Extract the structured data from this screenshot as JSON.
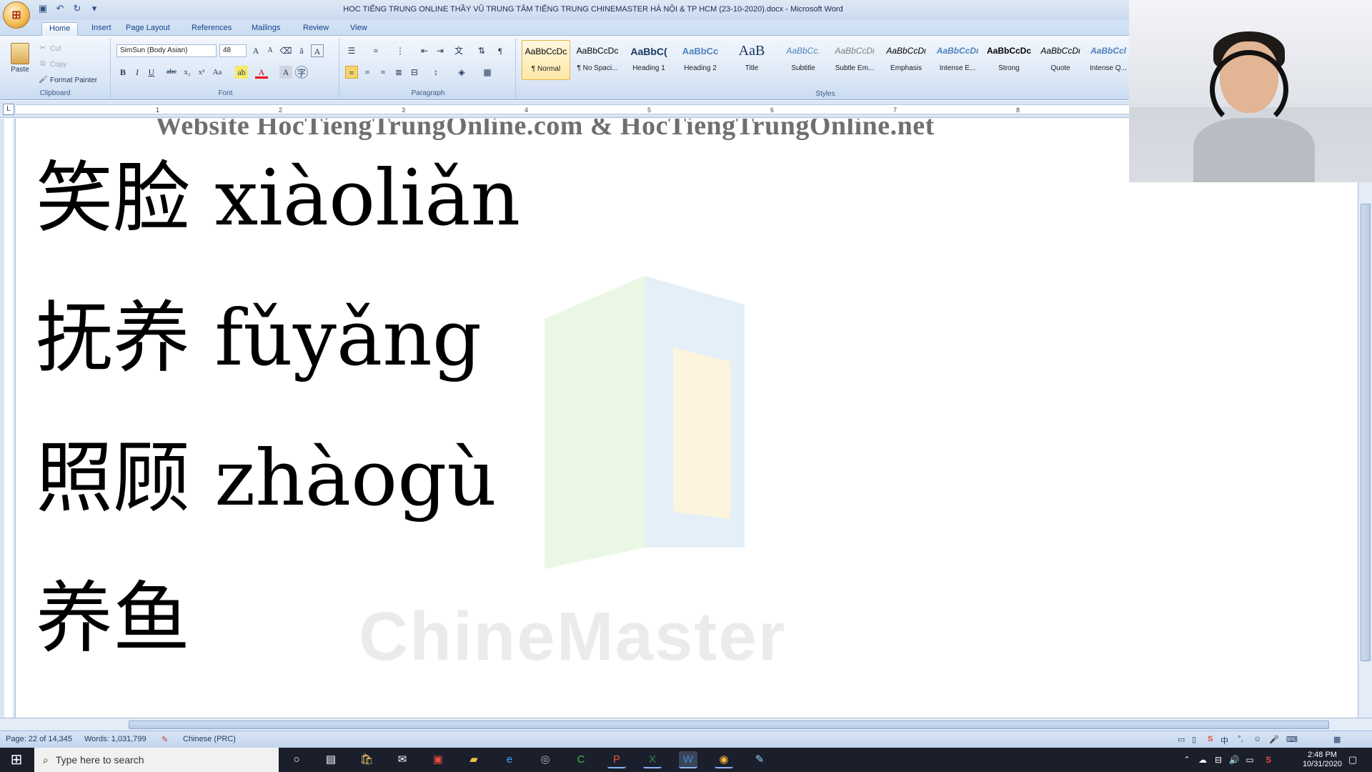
{
  "window": {
    "title": "HOC TIẾNG TRUNG ONLINE THẦY VŨ TRUNG TÂM TIẾNG TRUNG CHINEMASTER HÀ NỘI & TP HCM (23-10-2020).docx - Microsoft Word"
  },
  "tabs": [
    "Home",
    "Insert",
    "Page Layout",
    "References",
    "Mailings",
    "Review",
    "View"
  ],
  "ribbon": {
    "clipboard": {
      "paste": "Paste",
      "cut": "Cut",
      "copy": "Copy",
      "format_painter": "Format Painter",
      "label": "Clipboard"
    },
    "font": {
      "name": "SimSun (Body Asian)",
      "size": "48",
      "label": "Font"
    },
    "paragraph_label": "Paragraph",
    "styles_label": "Styles",
    "styles": [
      {
        "sample": "AaBbCcDc",
        "name": "¶ Normal"
      },
      {
        "sample": "AaBbCcDc",
        "name": "¶ No Spaci..."
      },
      {
        "sample": "AaBbC(",
        "name": "Heading 1"
      },
      {
        "sample": "AaBbCc",
        "name": "Heading 2"
      },
      {
        "sample": "AaB",
        "name": "Title"
      },
      {
        "sample": "AaBbCc.",
        "name": "Subtitle"
      },
      {
        "sample": "AaBbCcDι",
        "name": "Subtle Em..."
      },
      {
        "sample": "AaBbCcDι",
        "name": "Emphasis"
      },
      {
        "sample": "AaBbCcDι",
        "name": "Intense E..."
      },
      {
        "sample": "AaBbCcDc",
        "name": "Strong"
      },
      {
        "sample": "AaBbCcDι",
        "name": "Quote"
      },
      {
        "sample": "AaBbCcl",
        "name": "Intense Q..."
      }
    ],
    "accent_selected": "#f6c65a"
  },
  "ruler": {
    "numbers": [
      "1",
      "2",
      "3",
      "4",
      "5",
      "6",
      "7",
      "8"
    ]
  },
  "document": {
    "header_watermark": "Website HocTiengTrungOnline.com & HocTiengTrungOnline.net",
    "brand_watermark": "ChineMaster",
    "lines": [
      "笑脸 xiàoliǎn",
      "抚养 fǔyǎng",
      "照顾 zhàogù",
      "养鱼"
    ]
  },
  "status": {
    "page": "Page: 22 of 14,345",
    "words": "Words: 1,031,799",
    "language": "Chinese (PRC)"
  },
  "taskbar": {
    "search_placeholder": "Type here to search",
    "time": "2:48 PM",
    "date": "10/31/2020",
    "ime": "中"
  }
}
